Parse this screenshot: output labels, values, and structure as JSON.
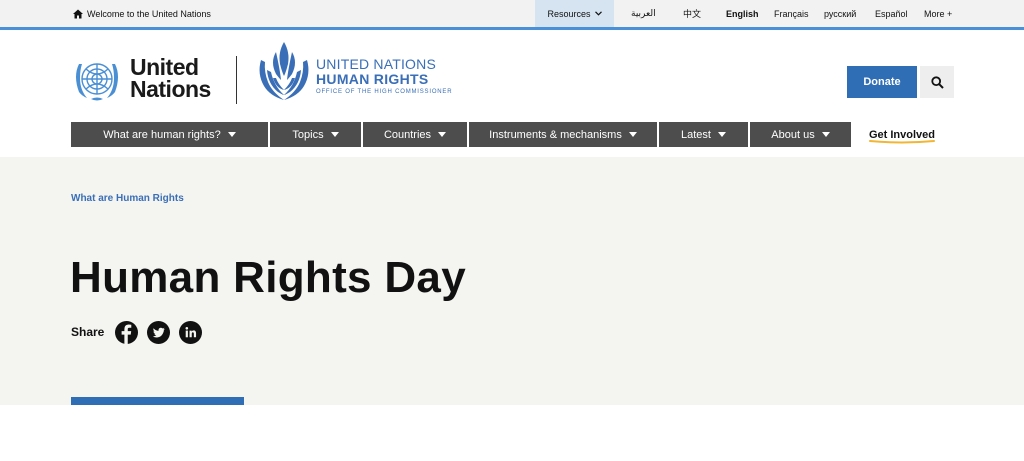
{
  "topbar": {
    "welcome_label": "Welcome to the United Nations",
    "resources_label": "Resources",
    "languages": [
      {
        "label": "العربية",
        "active": false
      },
      {
        "label": "中文",
        "active": false
      },
      {
        "label": "English",
        "active": true
      },
      {
        "label": "Français",
        "active": false
      },
      {
        "label": "русский",
        "active": false
      },
      {
        "label": "Español",
        "active": false
      },
      {
        "label": "More +",
        "active": false
      }
    ]
  },
  "header": {
    "un_wordmark_line1": "United",
    "un_wordmark_line2": "Nations",
    "ohchr_line1": "UNITED NATIONS",
    "ohchr_line2": "HUMAN RIGHTS",
    "ohchr_line3": "OFFICE OF THE HIGH COMMISSIONER",
    "donate_label": "Donate"
  },
  "nav": {
    "items": [
      {
        "label": "What are human rights?"
      },
      {
        "label": "Topics"
      },
      {
        "label": "Countries"
      },
      {
        "label": "Instruments & mechanisms"
      },
      {
        "label": "Latest"
      },
      {
        "label": "About us"
      }
    ],
    "get_involved_label": "Get Involved"
  },
  "hero": {
    "breadcrumb": "What are Human Rights",
    "title": "Human Rights Day",
    "share_label": "Share"
  },
  "icons": {
    "home": "home-icon",
    "chevron": "chevron-down-icon",
    "search": "search-icon",
    "facebook": "facebook-icon",
    "twitter": "twitter-icon",
    "linkedin": "linkedin-icon"
  },
  "colors": {
    "brand_blue": "#2f6db5",
    "ohchr_blue": "#3a6fb7",
    "topbar_accent": "#4a90d9",
    "nav_bg": "#4d4d4d",
    "hero_bg": "#f4f4f1",
    "get_involved_underline": "#f2b632"
  }
}
